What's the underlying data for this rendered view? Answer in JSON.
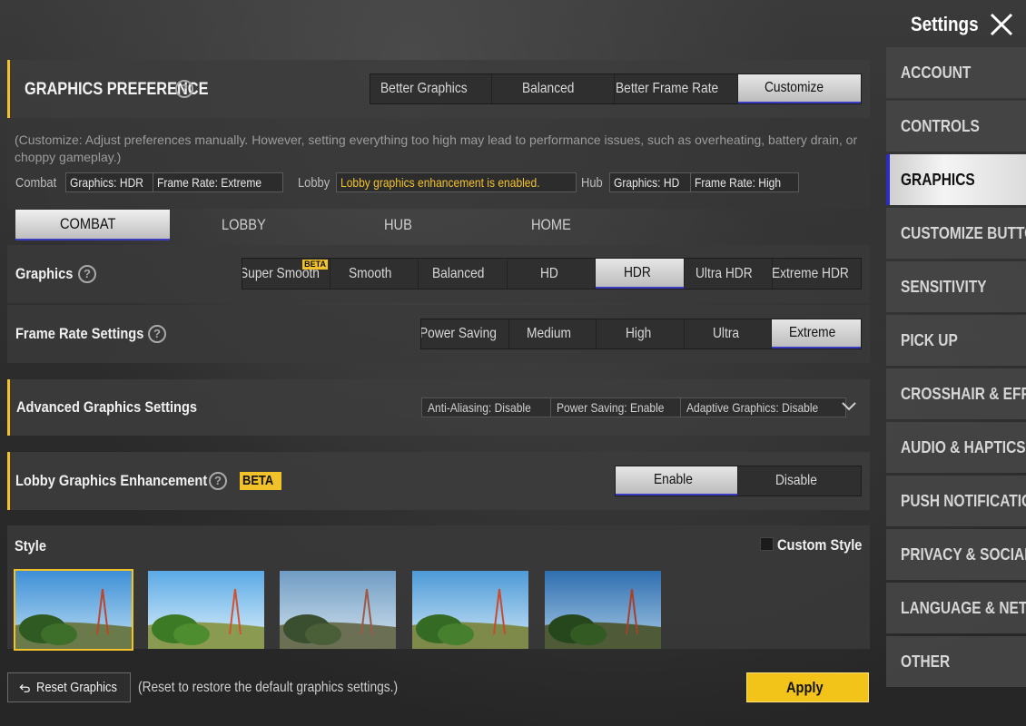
{
  "header": {
    "title": "Settings"
  },
  "sidebar": {
    "items": [
      {
        "label": "ACCOUNT"
      },
      {
        "label": "CONTROLS"
      },
      {
        "label": "GRAPHICS"
      },
      {
        "label": "CUSTOMIZE BUTTON"
      },
      {
        "label": "SENSITIVITY"
      },
      {
        "label": "PICK UP"
      },
      {
        "label": "CROSSHAIR & EFFECTS"
      },
      {
        "label": "AUDIO & HAPTICS"
      },
      {
        "label": "PUSH NOTIFICATIONS"
      },
      {
        "label": "PRIVACY & SOCIAL"
      },
      {
        "label": "LANGUAGE & NETWORK"
      },
      {
        "label": "OTHER"
      }
    ],
    "active_index": 2
  },
  "preference": {
    "title": "GRAPHICS PREFERENCE",
    "options": [
      "Better Graphics",
      "Balanced",
      "Better Frame Rate",
      "Customize"
    ],
    "selected": "Customize",
    "description": "(Customize: Adjust preferences manually. However, setting everything too high may lead to performance issues, such as overheating, battery drain, or choppy gameplay.)"
  },
  "summary": {
    "combat_label": "Combat",
    "combat_graphics": "Graphics: HDR",
    "combat_framerate": "Frame Rate: Extreme",
    "lobby_label": "Lobby",
    "lobby_note": "Lobby graphics enhancement is enabled.",
    "hub_label": "Hub",
    "hub_graphics": "Graphics: HD",
    "hub_framerate": "Frame Rate: High"
  },
  "mode_tabs": [
    "COMBAT",
    "LOBBY",
    "HUB",
    "HOME"
  ],
  "graphics": {
    "label": "Graphics",
    "options": [
      "Super Smooth",
      "Smooth",
      "Balanced",
      "HD",
      "HDR",
      "Ultra HDR",
      "Extreme HDR"
    ],
    "beta_tag": "BETA",
    "selected": "HDR"
  },
  "frame_rate": {
    "label": "Frame Rate Settings",
    "options": [
      "Power Saving",
      "Medium",
      "High",
      "Ultra",
      "Extreme"
    ],
    "selected": "Extreme"
  },
  "advanced": {
    "label": "Advanced Graphics Settings",
    "chips": [
      "Anti-Aliasing: Disable",
      "Power Saving: Enable",
      "Adaptive Graphics: Disable"
    ]
  },
  "lobby_enhancement": {
    "label": "Lobby Graphics Enhancement",
    "badge": "BETA",
    "options": [
      "Enable",
      "Disable"
    ],
    "selected": "Enable"
  },
  "style": {
    "label": "Style",
    "custom_label": "Custom Style",
    "thumbnail_count": 5,
    "selected_index": 0
  },
  "footer": {
    "reset_label": "Reset Graphics",
    "reset_note": "(Reset to restore the default graphics settings.)",
    "apply_label": "Apply"
  },
  "colors": {
    "accent": "#f2c22a",
    "selected_underline": "#3b3bc4",
    "apply": "#f2c318"
  }
}
